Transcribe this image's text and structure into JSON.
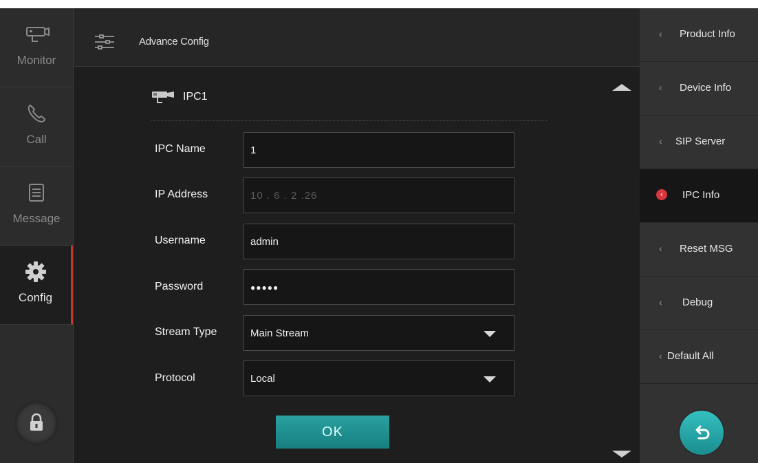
{
  "nav": [
    {
      "label": "Monitor",
      "icon": "monitor-camera-icon"
    },
    {
      "label": "Call",
      "icon": "phone-icon"
    },
    {
      "label": "Message",
      "icon": "message-icon"
    },
    {
      "label": "Config",
      "icon": "gear-icon",
      "active": true
    }
  ],
  "header": {
    "title": "Advance Config",
    "icon": "sliders-icon"
  },
  "section": {
    "title": "IPC1",
    "icon": "ip-camera-icon"
  },
  "form": {
    "ipc_name": {
      "label": "IPC Name",
      "value": "1"
    },
    "ip_address": {
      "label": "IP Address",
      "value": "10 . 6 . 2 .26"
    },
    "username": {
      "label": "Username",
      "value": "admin"
    },
    "password": {
      "label": "Password",
      "value": "●●●●●"
    },
    "stream_type": {
      "label": "Stream Type",
      "value": "Main Stream"
    },
    "protocol": {
      "label": "Protocol",
      "value": "Local"
    }
  },
  "ok_label": "OK",
  "menu": [
    {
      "label": "Product Info"
    },
    {
      "label": "Device Info"
    },
    {
      "label": "SIP Server"
    },
    {
      "label": "IPC Info",
      "active": true
    },
    {
      "label": "Reset MSG"
    },
    {
      "label": "Debug"
    },
    {
      "label": "Default All"
    }
  ],
  "colors": {
    "accent": "#1f9a9b",
    "active_marker": "#d9363e",
    "background": "#1e1e1e"
  }
}
